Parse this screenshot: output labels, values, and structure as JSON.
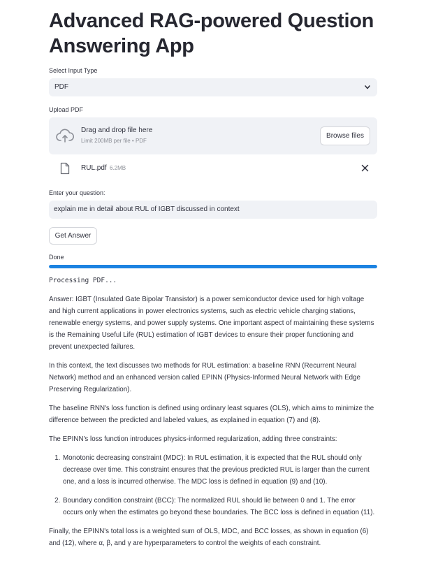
{
  "app": {
    "title": "Advanced RAG-powered Question Answering App"
  },
  "input_type": {
    "label": "Select Input Type",
    "selected": "PDF"
  },
  "upload": {
    "label": "Upload PDF",
    "drop_text": "Drag and drop file here",
    "limit_text": "Limit 200MB per file • PDF",
    "browse_label": "Browse files",
    "file": {
      "name": "RUL.pdf",
      "size": "6.2MB"
    }
  },
  "question": {
    "label": "Enter your question:",
    "value": "explain me in detail about RUL of IGBT discussed in context"
  },
  "get_answer_label": "Get Answer",
  "progress": {
    "status": "Done",
    "fraction": 1.0,
    "color": "#1c83e1"
  },
  "processing_text": "Processing PDF...",
  "answer": {
    "p1": "Answer: IGBT (Insulated Gate Bipolar Transistor) is a power semiconductor device used for high voltage and high current applications in power electronics systems, such as electric vehicle charging stations, renewable energy systems, and power supply systems. One important aspect of maintaining these systems is the Remaining Useful Life (RUL) estimation of IGBT devices to ensure their proper functioning and prevent unexpected failures.",
    "p2": "In this context, the text discusses two methods for RUL estimation: a baseline RNN (Recurrent Neural Network) method and an enhanced version called EPINN (Physics-Informed Neural Network with Edge Preserving Regularization).",
    "p3": "The baseline RNN's loss function is defined using ordinary least squares (OLS), which aims to minimize the difference between the predicted and labeled values, as explained in equation (7) and (8).",
    "p4": "The EPINN's loss function introduces physics-informed regularization, adding three constraints:",
    "items": [
      "Monotonic decreasing constraint (MDC): In RUL estimation, it is expected that the RUL should only decrease over time. This constraint ensures that the previous predicted RUL is larger than the current one, and a loss is incurred otherwise. The MDC loss is defined in equation (9) and (10).",
      "Boundary condition constraint (BCC): The normalized RUL should lie between 0 and 1. The error occurs only when the estimates go beyond these boundaries. The BCC loss is defined in equation (11)."
    ],
    "p5": "Finally, the EPINN's total loss is a weighted sum of OLS, MDC, and BCC losses, as shown in equation (6) and (12), where α, β, and γ are hyperparameters to control the weights of each constraint."
  },
  "icons": {
    "chevron": "chevron-down-icon",
    "upload": "cloud-upload-icon",
    "file": "file-icon",
    "close": "close-icon"
  }
}
